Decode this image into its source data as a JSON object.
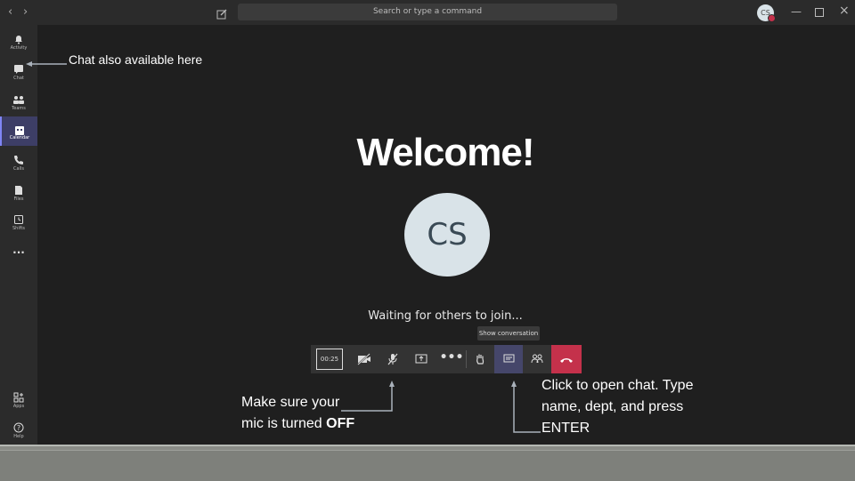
{
  "titlebar": {
    "back_icon": "chevron-left-icon",
    "forward_icon": "chevron-right-icon",
    "compose_icon": "compose-icon",
    "search_placeholder": "Search or type a command",
    "user_initials": "CS"
  },
  "sidebar": {
    "items": [
      {
        "label": "Activity",
        "icon": "bell-icon"
      },
      {
        "label": "Chat",
        "icon": "chat-icon"
      },
      {
        "label": "Teams",
        "icon": "teams-icon"
      },
      {
        "label": "Calendar",
        "icon": "calendar-icon",
        "active": true
      },
      {
        "label": "Calls",
        "icon": "phone-icon"
      },
      {
        "label": "Files",
        "icon": "file-icon"
      },
      {
        "label": "Shifts",
        "icon": "clock-icon"
      }
    ],
    "more_label": "...",
    "bottom_items": [
      {
        "label": "Apps",
        "icon": "apps-icon"
      },
      {
        "label": "Help",
        "icon": "help-icon"
      }
    ]
  },
  "meeting": {
    "welcome": "Welcome!",
    "avatar_initials": "CS",
    "waiting_text": "Waiting for others to join...",
    "tooltip": "Show conversation",
    "timer": "00:25"
  },
  "annotations": {
    "chat_side": "Chat also available here",
    "mic_line1": "Make sure your",
    "mic_line2_pre": "mic is turned ",
    "mic_line2_bold": "OFF",
    "chat_btn": "Click to open chat. Type name, dept, and press ENTER"
  },
  "colors": {
    "accent": "#7f85f5",
    "hangup": "#c4314b",
    "background": "#1f1f1f"
  }
}
